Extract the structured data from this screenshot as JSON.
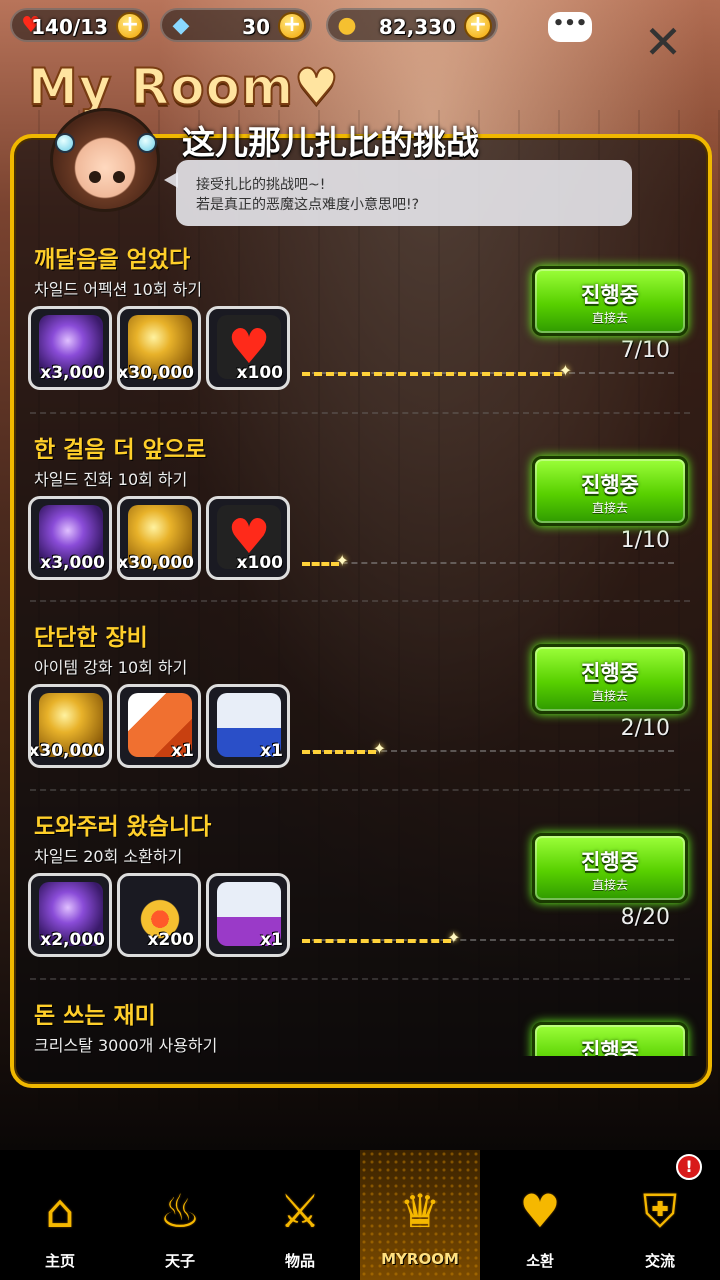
{
  "resources": {
    "hearts": "140/13",
    "gems": "30",
    "gold": "82,330"
  },
  "page_title": "My Room♥",
  "challenge": {
    "title": "这儿那儿扎比的挑战",
    "bubble_line1": "接受扎比的挑战吧~!",
    "bubble_line2": "若是真正的恶魔这点难度小意思吧!?"
  },
  "go_button": {
    "label": "진행중",
    "sub": "直接去"
  },
  "missions": [
    {
      "title": "깨달음을 얻었다",
      "desc": "차일드 어펙션 10회 하기",
      "rewards": [
        {
          "icon": "gem",
          "qty": "x3,000"
        },
        {
          "icon": "gold",
          "qty": "x30,000"
        },
        {
          "icon": "heart",
          "qty": "x100"
        }
      ],
      "progress": "7/10",
      "fraction": 0.7
    },
    {
      "title": "한 걸음 더 앞으로",
      "desc": "차일드 진화 10회 하기",
      "rewards": [
        {
          "icon": "gem",
          "qty": "x3,000"
        },
        {
          "icon": "gold",
          "qty": "x30,000"
        },
        {
          "icon": "heart",
          "qty": "x100"
        }
      ],
      "progress": "1/10",
      "fraction": 0.1
    },
    {
      "title": "단단한 장비",
      "desc": "아이템 강화 10회 하기",
      "rewards": [
        {
          "icon": "gold",
          "qty": "x30,000"
        },
        {
          "icon": "ticket",
          "qty": "x1"
        },
        {
          "icon": "card",
          "qty": "x1"
        }
      ],
      "progress": "2/10",
      "fraction": 0.2
    },
    {
      "title": "도와주러 왔습니다",
      "desc": "차일드 20회 소환하기",
      "rewards": [
        {
          "icon": "gem",
          "qty": "x2,000"
        },
        {
          "icon": "medal",
          "qty": "x200"
        },
        {
          "icon": "card2",
          "qty": "x1"
        }
      ],
      "progress": "8/20",
      "fraction": 0.4
    },
    {
      "title": "돈 쓰는 재미",
      "desc": "크리스탈 3000개 사용하기",
      "rewards": [],
      "progress": "",
      "fraction": 0
    }
  ],
  "nav": [
    {
      "label": "主页",
      "icon": "home-icon"
    },
    {
      "label": "天子",
      "icon": "flame-icon"
    },
    {
      "label": "物品",
      "icon": "sword-shield-icon"
    },
    {
      "label": "MYROOM",
      "icon": "crown-icon",
      "active": true
    },
    {
      "label": "소환",
      "icon": "potion-icon"
    },
    {
      "label": "交流",
      "icon": "shield-icon"
    }
  ],
  "notification_badge": "!"
}
